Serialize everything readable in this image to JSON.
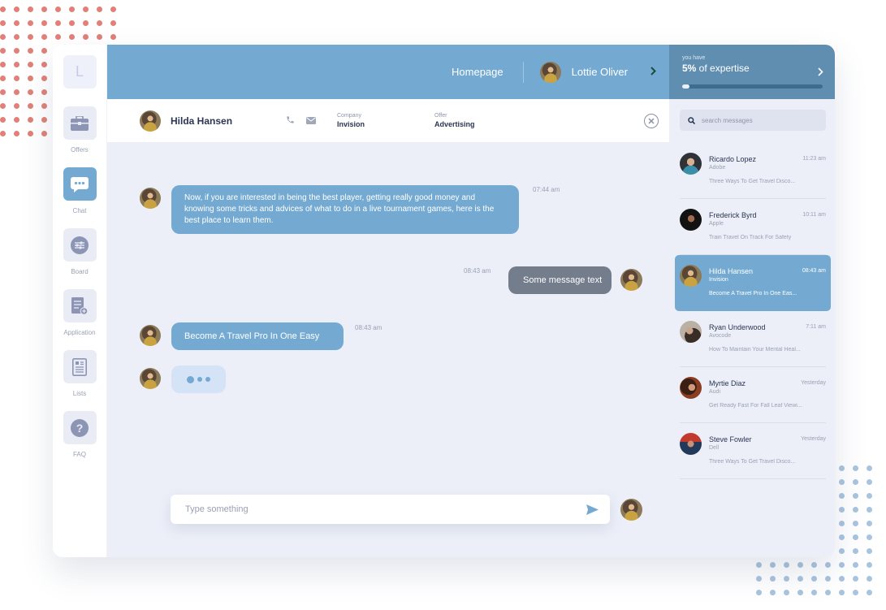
{
  "sidebar": {
    "logo": "L",
    "items": [
      {
        "label": "Offers",
        "icon": "briefcase-icon"
      },
      {
        "label": "Chat",
        "icon": "chat-bubble-icon",
        "active": true
      },
      {
        "label": "Board",
        "icon": "sliders-icon"
      },
      {
        "label": "Application",
        "icon": "document-add-icon"
      },
      {
        "label": "Lists",
        "icon": "list-document-icon"
      },
      {
        "label": "FAQ",
        "icon": "question-icon"
      }
    ]
  },
  "topbar": {
    "homepage": "Homepage",
    "user_name": "Lottie Oliver"
  },
  "chat_header": {
    "contact_name": "Hilda Hansen",
    "company_label": "Company",
    "company_value": "Invision",
    "offer_label": "Offer",
    "offer_value": "Advertising"
  },
  "messages": [
    {
      "direction": "in",
      "text": "Now, if you are interested in being the best player, getting really good money and knowing some tricks and advices of what to do in a live tournament games, here is the best place to learn them.",
      "time": "07:44 am"
    },
    {
      "direction": "out",
      "text": "Some message text",
      "time": "08:43 am"
    },
    {
      "direction": "in",
      "text": "Become A Travel Pro In One Easy",
      "time": "08:43 am"
    }
  ],
  "composer": {
    "placeholder": "Type something"
  },
  "expertise": {
    "small": "you have",
    "percent": "5%",
    "suffix": " of expertise",
    "progress": 0.05
  },
  "search": {
    "placeholder": "search messages"
  },
  "conversations": [
    {
      "name": "Ricardo Lopez",
      "company": "Adobe",
      "time": "11:23 am",
      "preview": "Three Ways To Get Travel Disco..."
    },
    {
      "name": "Frederick Byrd",
      "company": "Apple",
      "time": "10:11 am",
      "preview": "Train Travel On Track For Safety"
    },
    {
      "name": "Hilda Hansen",
      "company": "Invision",
      "time": "08:43 am",
      "preview": "Become A Travel Pro In One Eas...",
      "selected": true
    },
    {
      "name": "Ryan Underwood",
      "company": "Avocode",
      "time": "7:11 am",
      "preview": "How To Maintain Your Mental Heal..."
    },
    {
      "name": "Myrtie Diaz",
      "company": "Audi",
      "time": "Yesterday",
      "preview": "Get Ready Fast For Fall Leaf Viewi..."
    },
    {
      "name": "Steve Fowler",
      "company": "Dell",
      "time": "Yesterday",
      "preview": "Three Ways To Get Travel Disco..."
    }
  ],
  "colors": {
    "accent": "#74aad1",
    "accent_dark": "#5f8eb1",
    "background": "#eceff8",
    "text_dark": "#2a3552"
  }
}
